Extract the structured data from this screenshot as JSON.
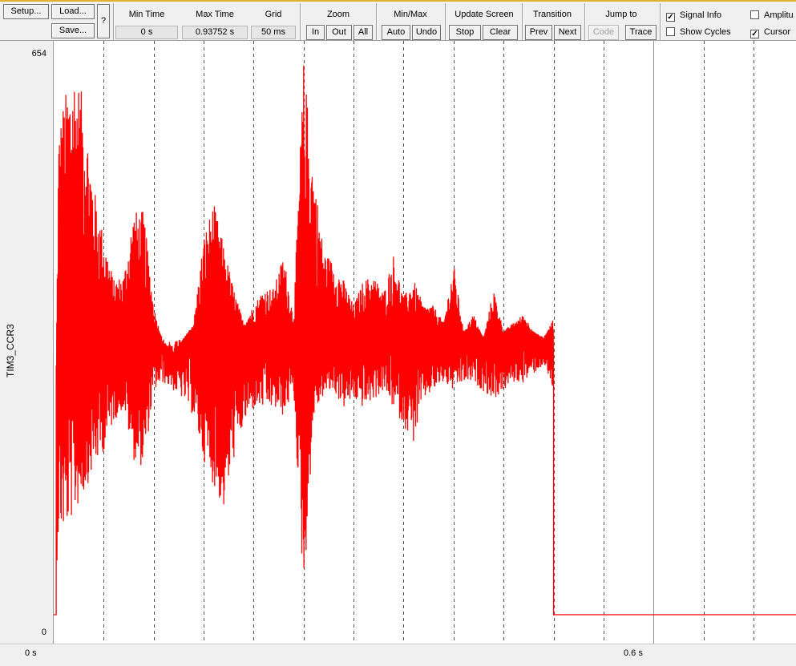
{
  "toolbar": {
    "setup_label": "Setup...",
    "load_label": "Load...",
    "save_label": "Save...",
    "help_label": "?",
    "min_time": {
      "label": "Min Time",
      "value": "0 s"
    },
    "max_time": {
      "label": "Max Time",
      "value": "0.93752 s"
    },
    "grid": {
      "label": "Grid",
      "value": "50 ms"
    },
    "zoom": {
      "label": "Zoom",
      "in": "In",
      "out": "Out",
      "all": "All"
    },
    "minmax": {
      "label": "Min/Max",
      "auto": "Auto",
      "undo": "Undo"
    },
    "update_screen": {
      "label": "Update Screen",
      "stop": "Stop",
      "clear": "Clear"
    },
    "transition": {
      "label": "Transition",
      "prev": "Prev",
      "next": "Next"
    },
    "jump_to": {
      "label": "Jump to",
      "code": "Code",
      "trace": "Trace"
    },
    "checkboxes": {
      "signal_info": {
        "label": "Signal Info",
        "checked": true
      },
      "amplitude": {
        "label": "Amplitu",
        "checked": false
      },
      "show_cycles": {
        "label": "Show Cycles",
        "checked": false
      },
      "cursor": {
        "label": "Cursor",
        "checked": true
      }
    }
  },
  "signal": {
    "name": "TIM3_CCR3",
    "ymax_label": "654",
    "ymin_label": "0",
    "color": "#ff0000"
  },
  "timeline": {
    "start_label": "0 s",
    "mark_label": "0.6 s"
  },
  "chart_data": {
    "type": "line",
    "series": [
      {
        "name": "TIM3_CCR3"
      }
    ],
    "xlim": [
      0,
      0.93752
    ],
    "ylim": [
      0,
      654
    ],
    "grid_interval_s": 0.05,
    "cursor_time_s": 0.6,
    "signal_end_time_s": 0.5,
    "final_value": 0,
    "envelope": {
      "t": [
        0.0,
        0.005,
        0.01,
        0.02,
        0.03,
        0.04,
        0.05,
        0.06,
        0.07,
        0.08,
        0.09,
        0.1,
        0.11,
        0.12,
        0.13,
        0.14,
        0.15,
        0.16,
        0.17,
        0.18,
        0.19,
        0.2,
        0.21,
        0.22,
        0.23,
        0.24,
        0.25,
        0.26,
        0.27,
        0.28,
        0.29,
        0.3,
        0.31,
        0.32,
        0.33,
        0.34,
        0.35,
        0.36,
        0.37,
        0.38,
        0.39,
        0.4,
        0.41,
        0.42,
        0.43,
        0.44,
        0.45,
        0.46,
        0.47,
        0.48,
        0.49,
        0.5
      ],
      "max": [
        0,
        565,
        600,
        640,
        600,
        500,
        440,
        390,
        395,
        470,
        470,
        360,
        310,
        305,
        320,
        340,
        440,
        480,
        430,
        380,
        340,
        360,
        380,
        380,
        420,
        345,
        645,
        520,
        425,
        410,
        390,
        360,
        390,
        395,
        375,
        420,
        370,
        390,
        360,
        360,
        340,
        410,
        330,
        350,
        320,
        380,
        330,
        340,
        350,
        330,
        320,
        345
      ],
      "min": [
        0,
        95,
        95,
        115,
        140,
        170,
        190,
        225,
        240,
        180,
        170,
        260,
        270,
        260,
        250,
        230,
        180,
        150,
        120,
        180,
        220,
        240,
        240,
        240,
        230,
        260,
        20,
        230,
        255,
        260,
        240,
        250,
        240,
        250,
        260,
        240,
        220,
        200,
        250,
        260,
        270,
        260,
        270,
        270,
        260,
        250,
        260,
        270,
        270,
        280,
        290,
        260
      ]
    }
  }
}
